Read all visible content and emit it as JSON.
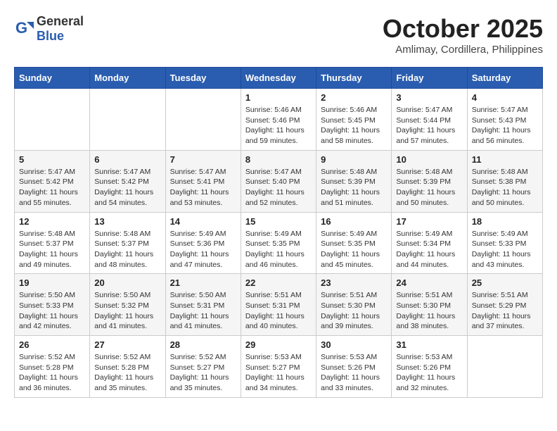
{
  "header": {
    "logo_general": "General",
    "logo_blue": "Blue",
    "month_title": "October 2025",
    "location": "Amlimay, Cordillera, Philippines"
  },
  "weekdays": [
    "Sunday",
    "Monday",
    "Tuesday",
    "Wednesday",
    "Thursday",
    "Friday",
    "Saturday"
  ],
  "weeks": [
    [
      {
        "day": "",
        "sunrise": "",
        "sunset": "",
        "daylight": ""
      },
      {
        "day": "",
        "sunrise": "",
        "sunset": "",
        "daylight": ""
      },
      {
        "day": "",
        "sunrise": "",
        "sunset": "",
        "daylight": ""
      },
      {
        "day": "1",
        "sunrise": "Sunrise: 5:46 AM",
        "sunset": "Sunset: 5:46 PM",
        "daylight": "Daylight: 11 hours and 59 minutes."
      },
      {
        "day": "2",
        "sunrise": "Sunrise: 5:46 AM",
        "sunset": "Sunset: 5:45 PM",
        "daylight": "Daylight: 11 hours and 58 minutes."
      },
      {
        "day": "3",
        "sunrise": "Sunrise: 5:47 AM",
        "sunset": "Sunset: 5:44 PM",
        "daylight": "Daylight: 11 hours and 57 minutes."
      },
      {
        "day": "4",
        "sunrise": "Sunrise: 5:47 AM",
        "sunset": "Sunset: 5:43 PM",
        "daylight": "Daylight: 11 hours and 56 minutes."
      }
    ],
    [
      {
        "day": "5",
        "sunrise": "Sunrise: 5:47 AM",
        "sunset": "Sunset: 5:42 PM",
        "daylight": "Daylight: 11 hours and 55 minutes."
      },
      {
        "day": "6",
        "sunrise": "Sunrise: 5:47 AM",
        "sunset": "Sunset: 5:42 PM",
        "daylight": "Daylight: 11 hours and 54 minutes."
      },
      {
        "day": "7",
        "sunrise": "Sunrise: 5:47 AM",
        "sunset": "Sunset: 5:41 PM",
        "daylight": "Daylight: 11 hours and 53 minutes."
      },
      {
        "day": "8",
        "sunrise": "Sunrise: 5:47 AM",
        "sunset": "Sunset: 5:40 PM",
        "daylight": "Daylight: 11 hours and 52 minutes."
      },
      {
        "day": "9",
        "sunrise": "Sunrise: 5:48 AM",
        "sunset": "Sunset: 5:39 PM",
        "daylight": "Daylight: 11 hours and 51 minutes."
      },
      {
        "day": "10",
        "sunrise": "Sunrise: 5:48 AM",
        "sunset": "Sunset: 5:39 PM",
        "daylight": "Daylight: 11 hours and 50 minutes."
      },
      {
        "day": "11",
        "sunrise": "Sunrise: 5:48 AM",
        "sunset": "Sunset: 5:38 PM",
        "daylight": "Daylight: 11 hours and 50 minutes."
      }
    ],
    [
      {
        "day": "12",
        "sunrise": "Sunrise: 5:48 AM",
        "sunset": "Sunset: 5:37 PM",
        "daylight": "Daylight: 11 hours and 49 minutes."
      },
      {
        "day": "13",
        "sunrise": "Sunrise: 5:48 AM",
        "sunset": "Sunset: 5:37 PM",
        "daylight": "Daylight: 11 hours and 48 minutes."
      },
      {
        "day": "14",
        "sunrise": "Sunrise: 5:49 AM",
        "sunset": "Sunset: 5:36 PM",
        "daylight": "Daylight: 11 hours and 47 minutes."
      },
      {
        "day": "15",
        "sunrise": "Sunrise: 5:49 AM",
        "sunset": "Sunset: 5:35 PM",
        "daylight": "Daylight: 11 hours and 46 minutes."
      },
      {
        "day": "16",
        "sunrise": "Sunrise: 5:49 AM",
        "sunset": "Sunset: 5:35 PM",
        "daylight": "Daylight: 11 hours and 45 minutes."
      },
      {
        "day": "17",
        "sunrise": "Sunrise: 5:49 AM",
        "sunset": "Sunset: 5:34 PM",
        "daylight": "Daylight: 11 hours and 44 minutes."
      },
      {
        "day": "18",
        "sunrise": "Sunrise: 5:49 AM",
        "sunset": "Sunset: 5:33 PM",
        "daylight": "Daylight: 11 hours and 43 minutes."
      }
    ],
    [
      {
        "day": "19",
        "sunrise": "Sunrise: 5:50 AM",
        "sunset": "Sunset: 5:33 PM",
        "daylight": "Daylight: 11 hours and 42 minutes."
      },
      {
        "day": "20",
        "sunrise": "Sunrise: 5:50 AM",
        "sunset": "Sunset: 5:32 PM",
        "daylight": "Daylight: 11 hours and 41 minutes."
      },
      {
        "day": "21",
        "sunrise": "Sunrise: 5:50 AM",
        "sunset": "Sunset: 5:31 PM",
        "daylight": "Daylight: 11 hours and 41 minutes."
      },
      {
        "day": "22",
        "sunrise": "Sunrise: 5:51 AM",
        "sunset": "Sunset: 5:31 PM",
        "daylight": "Daylight: 11 hours and 40 minutes."
      },
      {
        "day": "23",
        "sunrise": "Sunrise: 5:51 AM",
        "sunset": "Sunset: 5:30 PM",
        "daylight": "Daylight: 11 hours and 39 minutes."
      },
      {
        "day": "24",
        "sunrise": "Sunrise: 5:51 AM",
        "sunset": "Sunset: 5:30 PM",
        "daylight": "Daylight: 11 hours and 38 minutes."
      },
      {
        "day": "25",
        "sunrise": "Sunrise: 5:51 AM",
        "sunset": "Sunset: 5:29 PM",
        "daylight": "Daylight: 11 hours and 37 minutes."
      }
    ],
    [
      {
        "day": "26",
        "sunrise": "Sunrise: 5:52 AM",
        "sunset": "Sunset: 5:28 PM",
        "daylight": "Daylight: 11 hours and 36 minutes."
      },
      {
        "day": "27",
        "sunrise": "Sunrise: 5:52 AM",
        "sunset": "Sunset: 5:28 PM",
        "daylight": "Daylight: 11 hours and 35 minutes."
      },
      {
        "day": "28",
        "sunrise": "Sunrise: 5:52 AM",
        "sunset": "Sunset: 5:27 PM",
        "daylight": "Daylight: 11 hours and 35 minutes."
      },
      {
        "day": "29",
        "sunrise": "Sunrise: 5:53 AM",
        "sunset": "Sunset: 5:27 PM",
        "daylight": "Daylight: 11 hours and 34 minutes."
      },
      {
        "day": "30",
        "sunrise": "Sunrise: 5:53 AM",
        "sunset": "Sunset: 5:26 PM",
        "daylight": "Daylight: 11 hours and 33 minutes."
      },
      {
        "day": "31",
        "sunrise": "Sunrise: 5:53 AM",
        "sunset": "Sunset: 5:26 PM",
        "daylight": "Daylight: 11 hours and 32 minutes."
      },
      {
        "day": "",
        "sunrise": "",
        "sunset": "",
        "daylight": ""
      }
    ]
  ]
}
